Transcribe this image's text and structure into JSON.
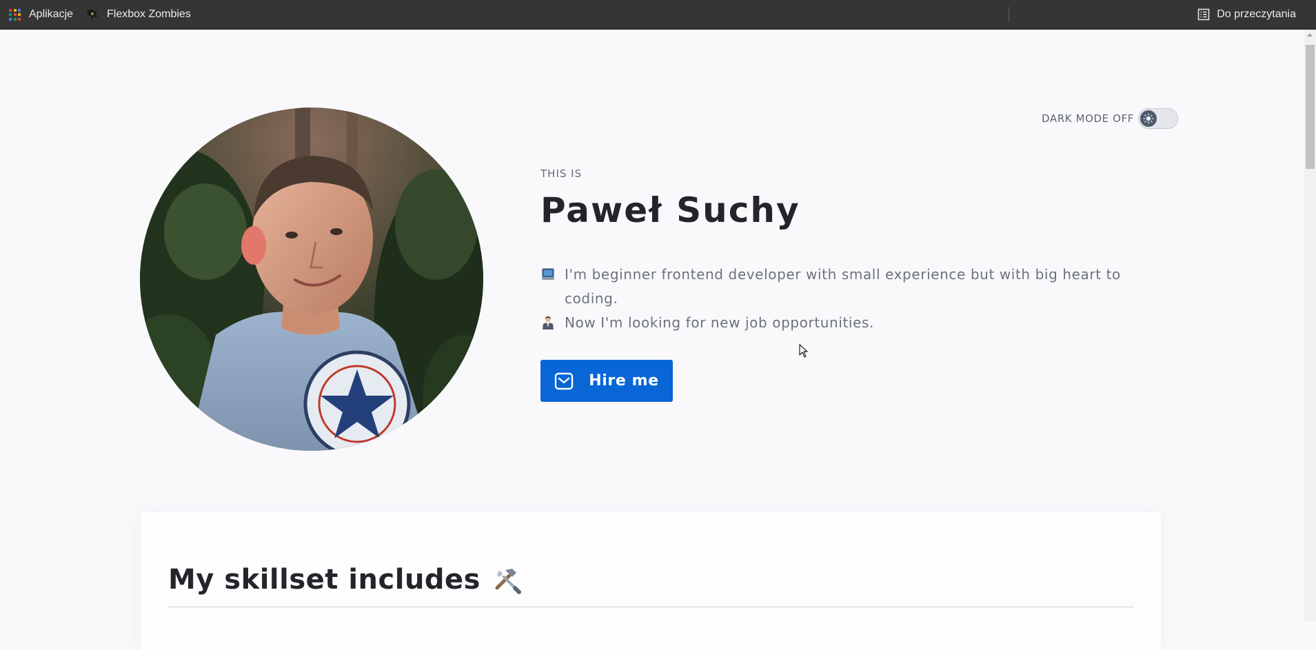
{
  "bookmarks": {
    "apps_label": "Aplikacje",
    "flexbox_label": "Flexbox Zombies",
    "reading_list_label": "Do przeczytania"
  },
  "theme_toggle": {
    "label": "DARK MODE OFF",
    "state": "off"
  },
  "intro": {
    "eyebrow": "THIS IS",
    "name": "Paweł Suchy",
    "bio_lines": [
      "I'm beginner frontend developer with small experience but with big heart to coding.",
      "Now I'm looking for new job opportunities."
    ],
    "hire_label": "Hire me"
  },
  "skills": {
    "heading": "My skillset includes"
  },
  "colors": {
    "accent": "#0866d6",
    "heading": "#23252b",
    "body_text": "#6b717c",
    "page_bg": "#f9f9fc",
    "bookmarks_bg": "#353535"
  },
  "icons": [
    "apps-grid-icon",
    "zombie-favicon-icon",
    "reading-list-icon",
    "sun-icon",
    "laptop-emoji-icon",
    "office-worker-emoji-icon",
    "mail-icon",
    "tools-icon",
    "mouse-cursor-icon"
  ]
}
